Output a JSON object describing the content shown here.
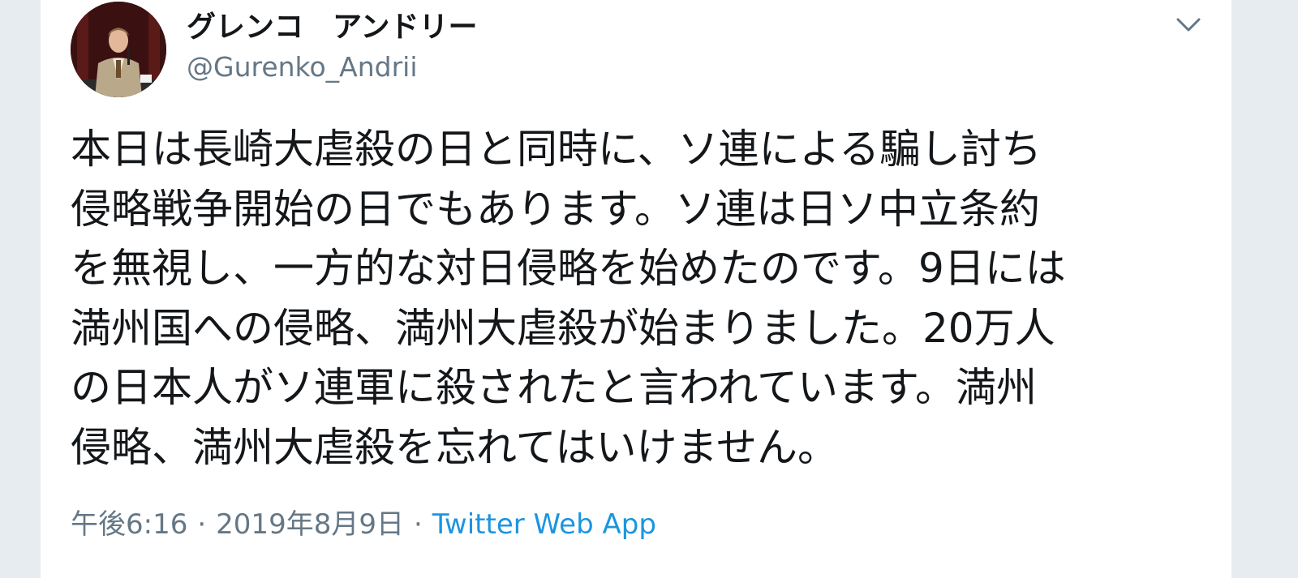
{
  "tweet": {
    "author": {
      "display_name": "グレンコ　アンドリー",
      "handle": "@Gurenko_Andrii"
    },
    "menu_icon": "chevron-down-icon",
    "text_lines": [
      "本日は長崎大虐殺の日と同時に、ソ連による騙し討ち",
      "侵略戦争開始の日でもあります。ソ連は日ソ中立条約",
      "を無視し、一方的な対日侵略を始めたのです。9日には",
      "満州国への侵略、満州大虐殺が始まりました。20万人",
      "の日本人がソ連軍に殺されたと言われています。満州",
      "侵略、満州大虐殺を忘れてはいけません。"
    ],
    "time": "午後6:16",
    "separator": "·",
    "date": "2019年8月9日",
    "source": "Twitter Web App"
  },
  "colors": {
    "background": "#e6ecf0",
    "card": "#ffffff",
    "text": "#14171a",
    "muted": "#657786",
    "link": "#1b95e0"
  }
}
